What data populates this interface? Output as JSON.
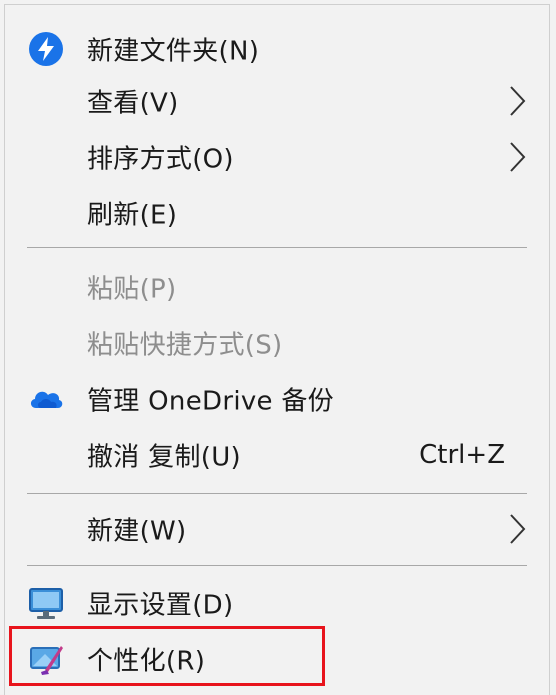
{
  "context_menu": {
    "items": [
      {
        "label": "新建文件夹(N)",
        "icon": "lightning-circle-icon"
      },
      {
        "label": "查看(V)",
        "submenu": true
      },
      {
        "label": "排序方式(O)",
        "submenu": true
      },
      {
        "label": "刷新(E)"
      },
      {
        "label": "粘贴(P)",
        "disabled": true
      },
      {
        "label": "粘贴快捷方式(S)",
        "disabled": true
      },
      {
        "label": "管理 OneDrive 备份",
        "icon": "onedrive-cloud-icon"
      },
      {
        "label": "撤消 复制(U)",
        "shortcut": "Ctrl+Z"
      },
      {
        "label": "新建(W)",
        "submenu": true
      },
      {
        "label": "显示设置(D)",
        "icon": "display-settings-icon"
      },
      {
        "label": "个性化(R)",
        "icon": "personalize-icon",
        "highlighted": true
      }
    ]
  },
  "colors": {
    "menu_bg": "#f2f2f2",
    "text": "#1a1a1a",
    "disabled_text": "#8e8e8e",
    "separator": "#a8a8a8",
    "highlight_border": "#e8141c",
    "accent_blue": "#1a73e8"
  }
}
